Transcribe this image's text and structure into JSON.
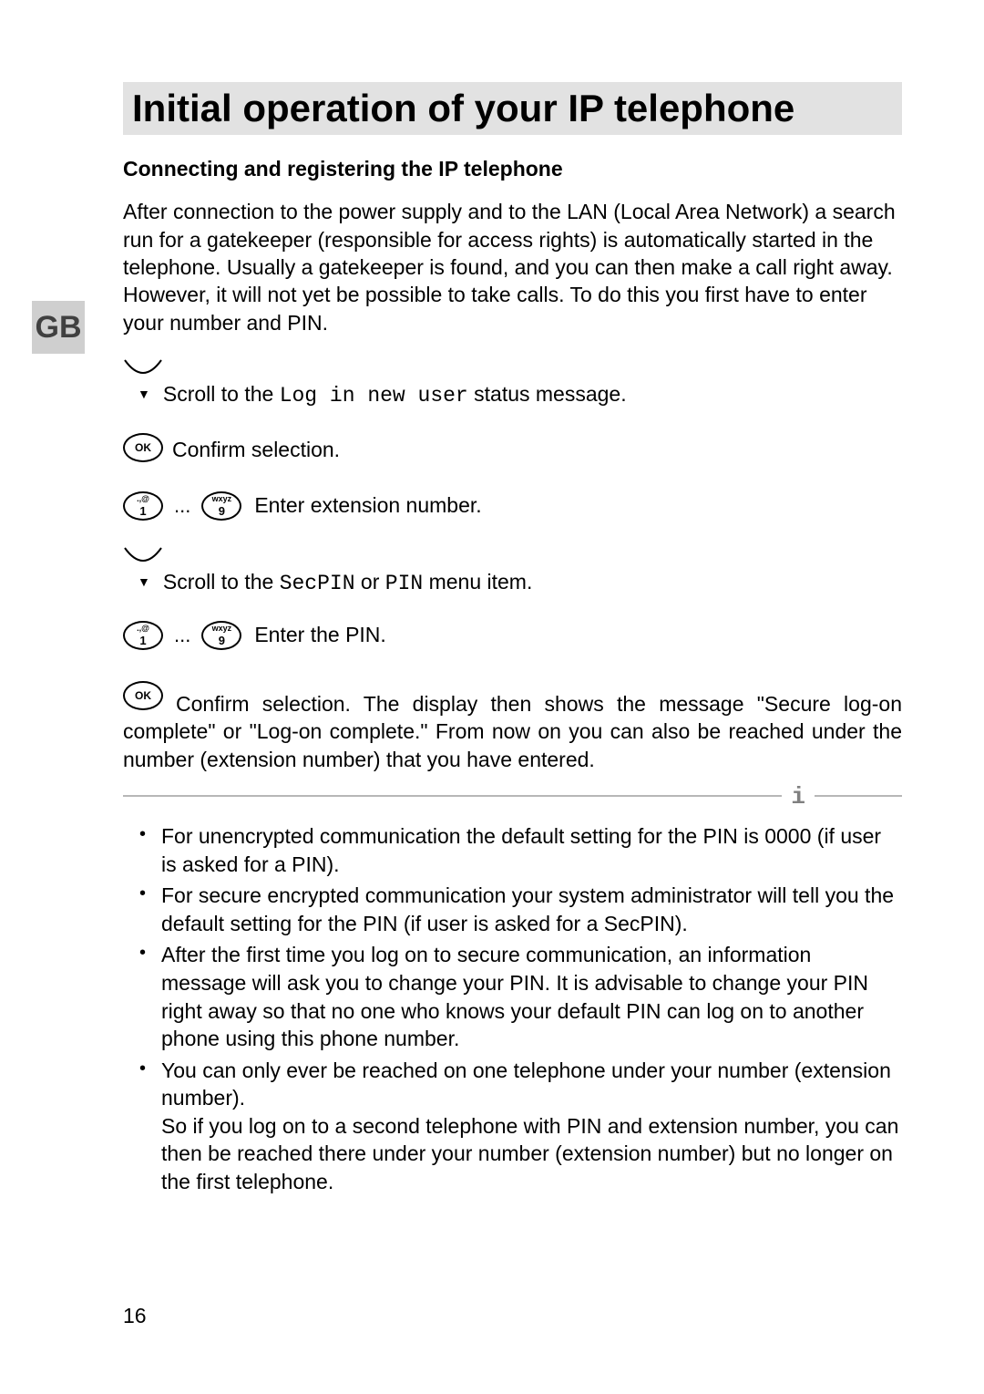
{
  "lang_badge": "GB",
  "title": "Initial operation of your IP telephone",
  "subheading": "Connecting and registering the IP telephone",
  "intro": "After connection to the power supply and to the LAN (Local Area Network) a search run for a gatekeeper (responsible for access rights) is automatically started in the telephone. Usually a gatekeeper is found, and you can then make a call right away. However, it will not yet be possible to take calls. To do this you first have to enter your number and PIN.",
  "steps": {
    "s1_pre": "Scroll to the ",
    "s1_code": "Log in new user",
    "s1_post": " status message.",
    "s2": "Confirm selection.",
    "s3": "Enter extension number.",
    "s4_pre": "Scroll to the ",
    "s4_code1": "SecPIN",
    "s4_mid": " or ",
    "s4_code2": "PIN",
    "s4_post": " menu item.",
    "s5": "Enter the PIN.",
    "s6": "Confirm selection. The display then shows the message \"Secure log-on complete\" or \"Log-on complete.\" From now on you can also be reached under the number (extension number) that you have entered."
  },
  "info_mark": "i",
  "info_items": [
    "For unencrypted communication the default setting for the PIN is 0000 (if user is asked for a PIN).",
    "For secure encrypted communication your system administrator will tell you the default setting for the PIN (if user is asked for a SecPIN).",
    "After the first time you log on to secure communication, an information message will ask you to change your PIN. It is advisable to change your PIN right away so that no one who knows your default PIN can log on to another phone using this phone number.",
    "You can only ever be reached on one telephone under your number (extension number).\nSo if you log on to a second telephone with PIN and extension number, you can then be reached there under your number (extension number) but no longer on the first telephone."
  ],
  "keys": {
    "ok": "OK",
    "k1_top": ".,@",
    "k1_num": "1",
    "k9_top": "wxyz",
    "k9_num": "9",
    "ellipsis": "..."
  },
  "page_number": "16"
}
